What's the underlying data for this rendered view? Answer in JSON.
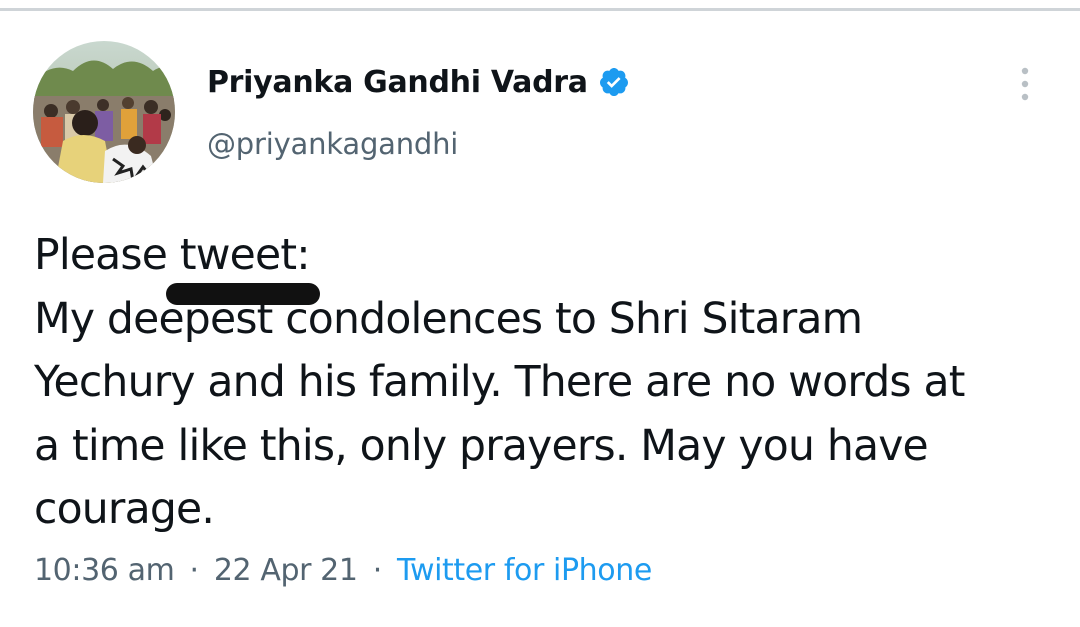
{
  "tweet": {
    "author": {
      "display_name": "Priyanka Gandhi Vadra",
      "handle": "@priyankagandhi",
      "verified": true,
      "avatar_icon": "profile-photo-avatar"
    },
    "text_lines": [
      "Please tweet:",
      "My deepest condolences to Shri Sitaram",
      "Yechury and his family. There are no words at",
      "a time like this, only prayers. May you have",
      "courage."
    ],
    "redacted": true,
    "meta": {
      "time": "10:36 am",
      "separator": "·",
      "date": "22 Apr 21",
      "source": "Twitter for iPhone"
    },
    "icons": {
      "verified": "verified-badge-icon",
      "more": "more-options-icon"
    },
    "colors": {
      "text": "#0f1419",
      "secondary": "#536471",
      "accent": "#1d9bf0",
      "redaction": "#111111"
    }
  }
}
